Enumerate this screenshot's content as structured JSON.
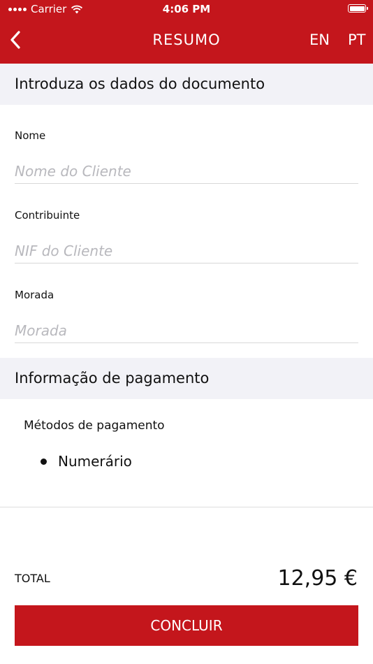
{
  "status_bar": {
    "carrier": "Carrier",
    "time": "4:06 PM",
    "icons": [
      "signal-icon",
      "wifi-icon",
      "battery-icon"
    ]
  },
  "nav": {
    "title": "RESUMO",
    "back_icon": "chevron-left-icon",
    "lang_en": "EN",
    "lang_pt": "PT"
  },
  "document_section": {
    "title": "Introduza os dados do documento",
    "fields": [
      {
        "label": "Nome",
        "placeholder": "Nome do Cliente",
        "value": ""
      },
      {
        "label": "Contribuinte",
        "placeholder": "NIF do Cliente",
        "value": ""
      },
      {
        "label": "Morada",
        "placeholder": "Morada",
        "value": ""
      }
    ]
  },
  "payment_section": {
    "title": "Informação de pagamento",
    "methods_label": "Métodos de pagamento",
    "methods": [
      "Numerário"
    ]
  },
  "summary": {
    "total_label": "TOTAL",
    "total_value": "12,95 €"
  },
  "actions": {
    "conclude_label": "CONCLUIR"
  },
  "colors": {
    "brand_red": "#c4161c",
    "section_background": "#f2f2f7",
    "placeholder_text": "#b8b8bd"
  }
}
